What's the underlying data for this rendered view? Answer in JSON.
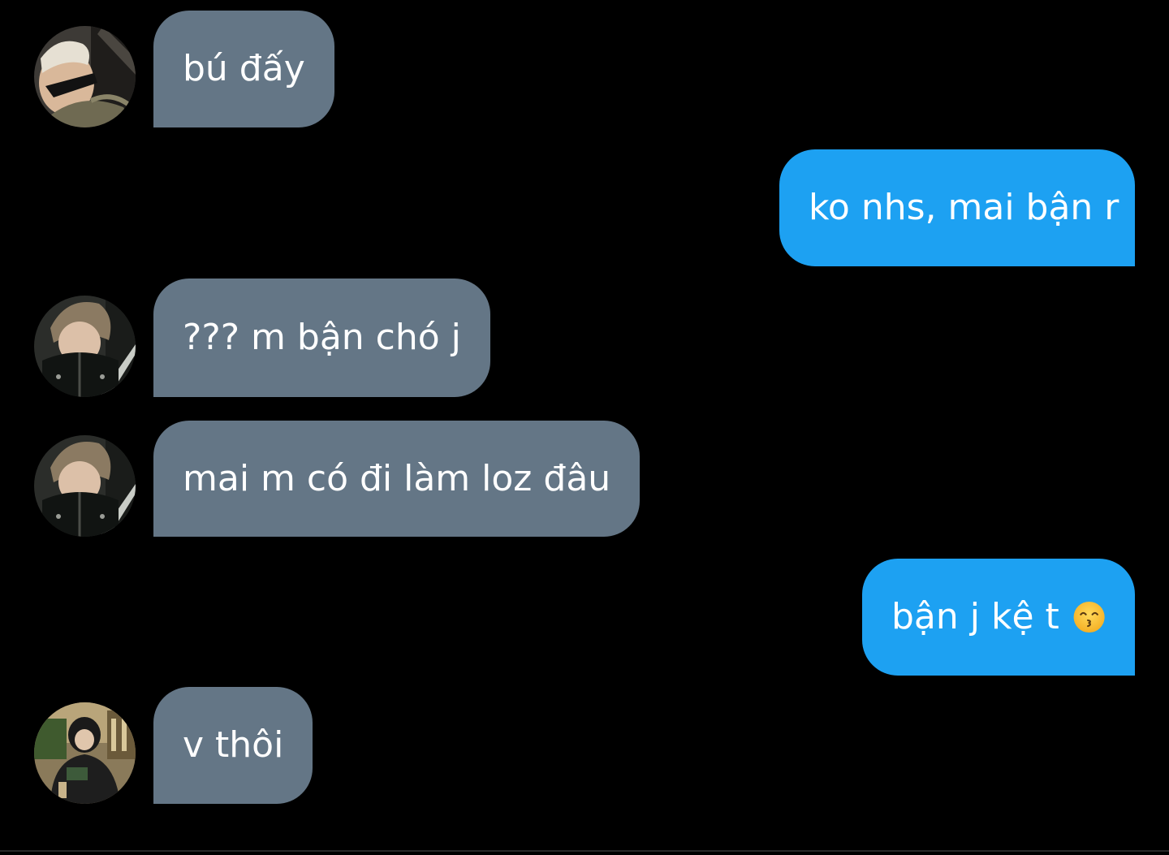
{
  "colors": {
    "background": "#000000",
    "incoming_bubble": "#647686",
    "outgoing_bubble": "#1da1f2",
    "bubble_text": "#ffffff"
  },
  "messages": [
    {
      "direction": "incoming",
      "avatar": "avatar-sunglasses-photo",
      "text": "bú đấy"
    },
    {
      "direction": "outgoing",
      "text": "ko nhs, mai bận r"
    },
    {
      "direction": "incoming",
      "avatar": "avatar-hoodie-photo",
      "text": "??? m bận chó j"
    },
    {
      "direction": "incoming",
      "avatar": "avatar-hoodie-photo",
      "text": "mai m có đi làm loz đâu"
    },
    {
      "direction": "outgoing",
      "text": "bận j kệ t",
      "emoji": "kissing-smiling-eyes-emoji"
    },
    {
      "direction": "incoming",
      "avatar": "avatar-cafe-photo",
      "text": "v thôi"
    }
  ]
}
